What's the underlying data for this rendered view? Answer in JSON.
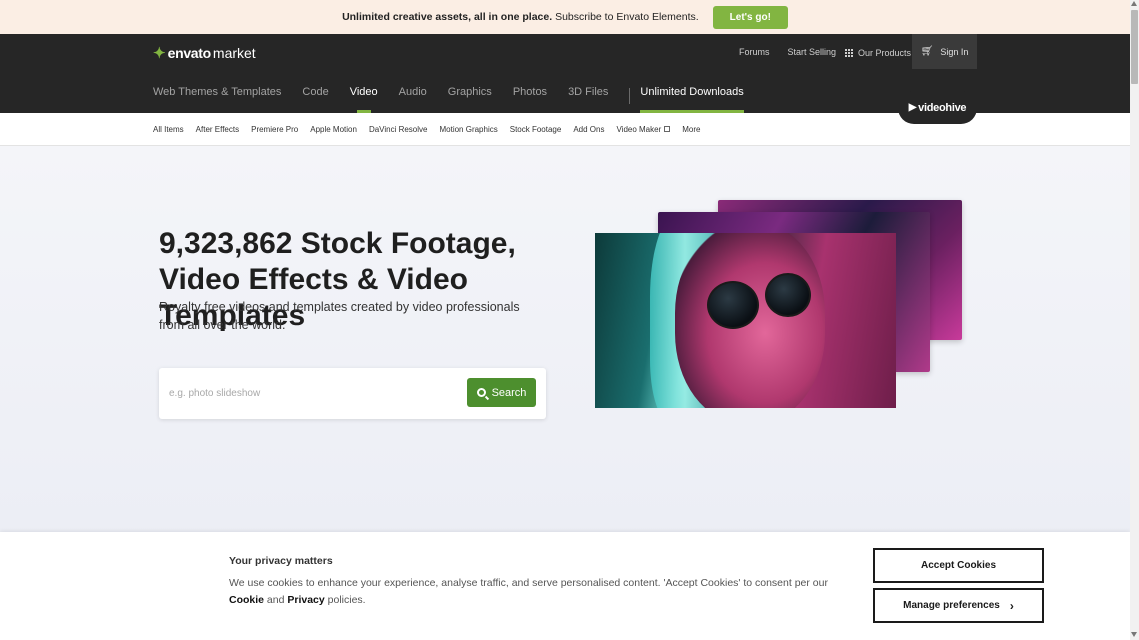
{
  "promo": {
    "text_bold": "Unlimited creative assets, all in one place.",
    "text_rest": "Subscribe to Envato Elements.",
    "button_label": "Let's go!"
  },
  "header": {
    "logo": {
      "mark": "✦",
      "brand": "envato",
      "product": "market"
    },
    "forums_label": "Forums",
    "start_selling_label": "Start Selling",
    "our_products_label": "Our Products",
    "sign_in_label": "Sign In",
    "main_nav": [
      "Web Themes & Templates",
      "Code",
      "Video",
      "Audio",
      "Graphics",
      "Photos",
      "3D Files"
    ],
    "active_nav": "Video",
    "unlimited_label": "Unlimited Downloads",
    "videohive_label": "videohive"
  },
  "subnav": {
    "items": [
      "All Items",
      "After Effects",
      "Premiere Pro",
      "Apple Motion",
      "DaVinci Resolve",
      "Motion Graphics",
      "Stock Footage",
      "Add Ons",
      "Video Maker",
      "More"
    ],
    "external_item": "Video Maker"
  },
  "hero": {
    "title": "9,323,862 Stock Footage, Video Effects & Video Templates",
    "subtitle": "Royalty free videos and templates created by video professionals from all over the world.",
    "search_placeholder": "e.g. photo slideshow",
    "search_button_label": "Search"
  },
  "cookie": {
    "title": "Your privacy matters",
    "text_part1": "We use cookies to enhance your experience, analyse traffic, and serve personalised content. 'Accept Cookies' to consent per our ",
    "cookie_link": "Cookie",
    "and": " and ",
    "privacy_link": "Privacy",
    "text_part2": " policies.",
    "accept_label": "Accept Cookies",
    "manage_label": "Manage preferences"
  },
  "colors": {
    "accent_green": "#82b541",
    "search_green": "#4d8f2e",
    "header_dark": "#262626",
    "promo_bg": "#fbeee4"
  }
}
